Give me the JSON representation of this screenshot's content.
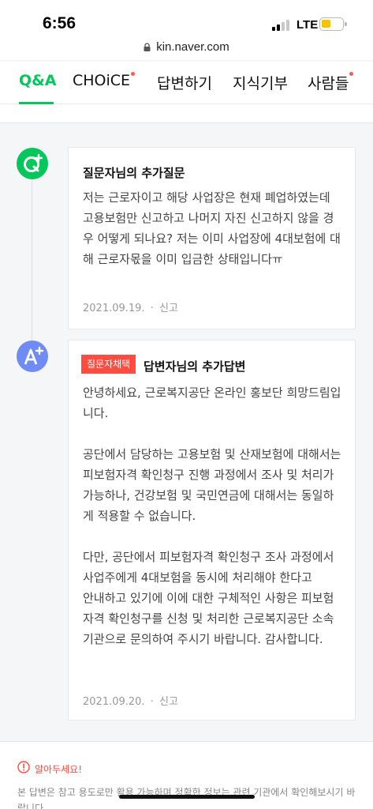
{
  "status_bar": {
    "time": "6:56",
    "network": "LTE",
    "battery_level": 0.45,
    "battery_color": "#f5c400"
  },
  "url_bar": {
    "domain": "kin.naver.com",
    "icon": "lock-icon"
  },
  "tabs": [
    {
      "label": "Q&A",
      "active": true
    },
    {
      "label": "CHOiCE",
      "has_dot": true
    },
    {
      "label": "답변하기"
    },
    {
      "label": "지식기부"
    },
    {
      "label": "사람들",
      "has_dot": true
    }
  ],
  "colors": {
    "accent": "#03c75a",
    "badge": "#ff4c41",
    "answer_avatar": "#6f8cf5"
  },
  "question": {
    "icon": "question-plus-icon",
    "title": "질문자님의 추가질문",
    "body": "저는 근로자이고 해당 사업장은 현재 폐업하였는데 고용보험만 신고하고 나머지 자진 신고하지 않을 경우 어떻게 되나요? 저는 이미 사업장에 4대보험에 대해 근로자몫을 이미 입금한 상태입니다ㅠ",
    "date": "2021.09.19.",
    "report": "신고"
  },
  "answer": {
    "icon": "answer-plus-icon",
    "badge": "질문자채택",
    "title": "답변자님의 추가답변",
    "body": "안녕하세요, 근로복지공단 온라인 홍보단 희망드림입니다.\n\n공단에서 담당하는 고용보험 및 산재보험에 대해서는 피보험자격 확인청구 진행 과정에서 조사 및 처리가 가능하나, 건강보험 및 국민연금에 대해서는 동일하게 적용할 수 없습니다.\n\n다만, 공단에서 피보험자격 확인청구 조사 과정에서 사업주에게 4대보험을 동시에 처리해야 한다고\n안내하고 있기에 이에 대한 구체적인 사항은 피보험자격 확인청구를 신청 및 처리한 근로복지공단 소속기관으로 문의하여 주시기 바랍니다. 감사합니다.",
    "date": "2021.09.20.",
    "report": "신고"
  },
  "notice": {
    "icon": "warning-circle-icon",
    "title": "알아두세요!",
    "text": "본 답변은 참고 용도로만 활용 가능하며 정확한 정보는 관련 기관에서 확인해보시기 바랍니다."
  }
}
